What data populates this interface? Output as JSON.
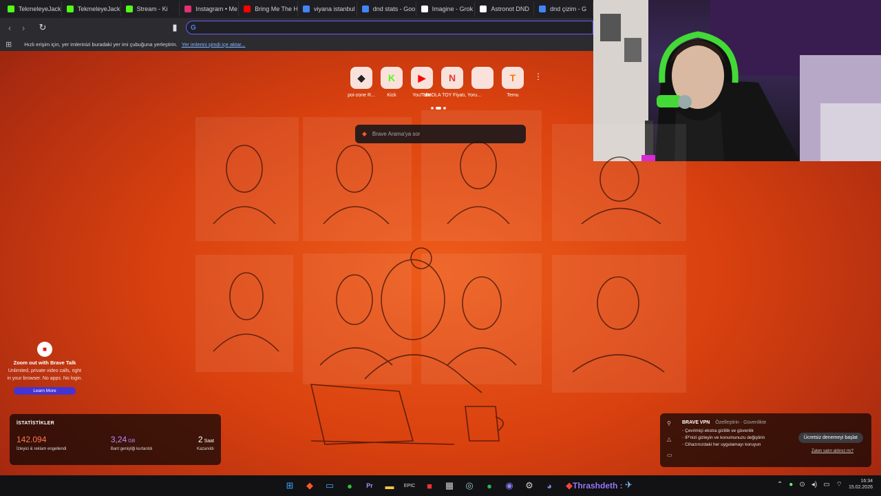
{
  "tabs": [
    {
      "label": "TekmeleyeJack",
      "icon": "kick-icon",
      "color": "#53fc18"
    },
    {
      "label": "TekmeleyeJack",
      "icon": "kick-icon",
      "color": "#53fc18"
    },
    {
      "label": "Stream - Ki",
      "icon": "kick-icon",
      "color": "#53fc18"
    },
    {
      "label": "Instagram • Me",
      "icon": "instagram-icon",
      "color": "#e1306c"
    },
    {
      "label": "Bring Me The H",
      "icon": "youtube-icon",
      "color": "#ff0000"
    },
    {
      "label": "viyana istanbul",
      "icon": "google-icon",
      "color": "#4285f4"
    },
    {
      "label": "dnd stats - Goo",
      "icon": "google-icon",
      "color": "#4285f4"
    },
    {
      "label": "Imagine - Grok",
      "icon": "grok-icon",
      "color": "#ffffff"
    },
    {
      "label": "Astronot DND",
      "icon": "chatgpt-icon",
      "color": "#ffffff"
    },
    {
      "label": "dnd çizim - G",
      "icon": "google-icon",
      "color": "#4285f4"
    }
  ],
  "toolbar": {
    "search_value": ""
  },
  "bookmarks": {
    "text": "Hızlı erişim için, yer imlerinizi buradaki yer imi çubuğuna yerleştirin.",
    "link": "Yer imlerini şimdi içe aktar..."
  },
  "top_sites": [
    {
      "label": "poi-zone R...",
      "icon": "poizone-icon",
      "glyph": "◆",
      "color": "#222"
    },
    {
      "label": "Kick",
      "icon": "kick-icon",
      "glyph": "K",
      "color": "#53fc18"
    },
    {
      "label": "YouTube",
      "icon": "youtube-icon",
      "glyph": "▶",
      "color": "#ff0000"
    },
    {
      "label": "NIKOLA TOY Fiyatı, Yoru...",
      "icon": "nikola-icon",
      "glyph": "N",
      "color": "#e53935"
    },
    {
      "label": "",
      "icon": "site-icon",
      "glyph": "",
      "color": "#e88"
    },
    {
      "label": "Temu",
      "icon": "temu-icon",
      "glyph": "T",
      "color": "#fb7701"
    }
  ],
  "search": {
    "placeholder": "Brave Arama'ya sor"
  },
  "talk": {
    "title": "Zoom out with Brave Talk",
    "body": "Unlimited, private video calls, right in your browser. No apps. No login.",
    "button": "Learn More"
  },
  "stats": {
    "heading": "İSTATİSTİKLER",
    "items": [
      {
        "value": "142.094",
        "unit": "",
        "desc": "İzleyici & reklam engellendi",
        "color": "#ff7a4d"
      },
      {
        "value": "3,24",
        "unit": "GB",
        "desc": "Bant genişliği kurtarıldı",
        "color": "#b98cff"
      },
      {
        "value": "2",
        "unit": "Saat",
        "desc": "Kazanıldı",
        "color": "#ffffff"
      }
    ]
  },
  "vpn": {
    "title": "BRAVE VPN",
    "subtitle": "Özelleştirin · Güvenlikte",
    "items": [
      "Çevrimiçi ekstra gizlilik ve güvenlik",
      "IP'nizi gizleyin ve konumunuzu değiştirin",
      "Cihazınızdaki her uygulamayı koruyun"
    ],
    "cta": "Ücretsiz denemeyi başlat",
    "link": "Zaten satın aldınız mı?"
  },
  "taskbar": {
    "user_label": "Thrashdeth :",
    "time": "16:34",
    "date": "15.02.2026"
  }
}
